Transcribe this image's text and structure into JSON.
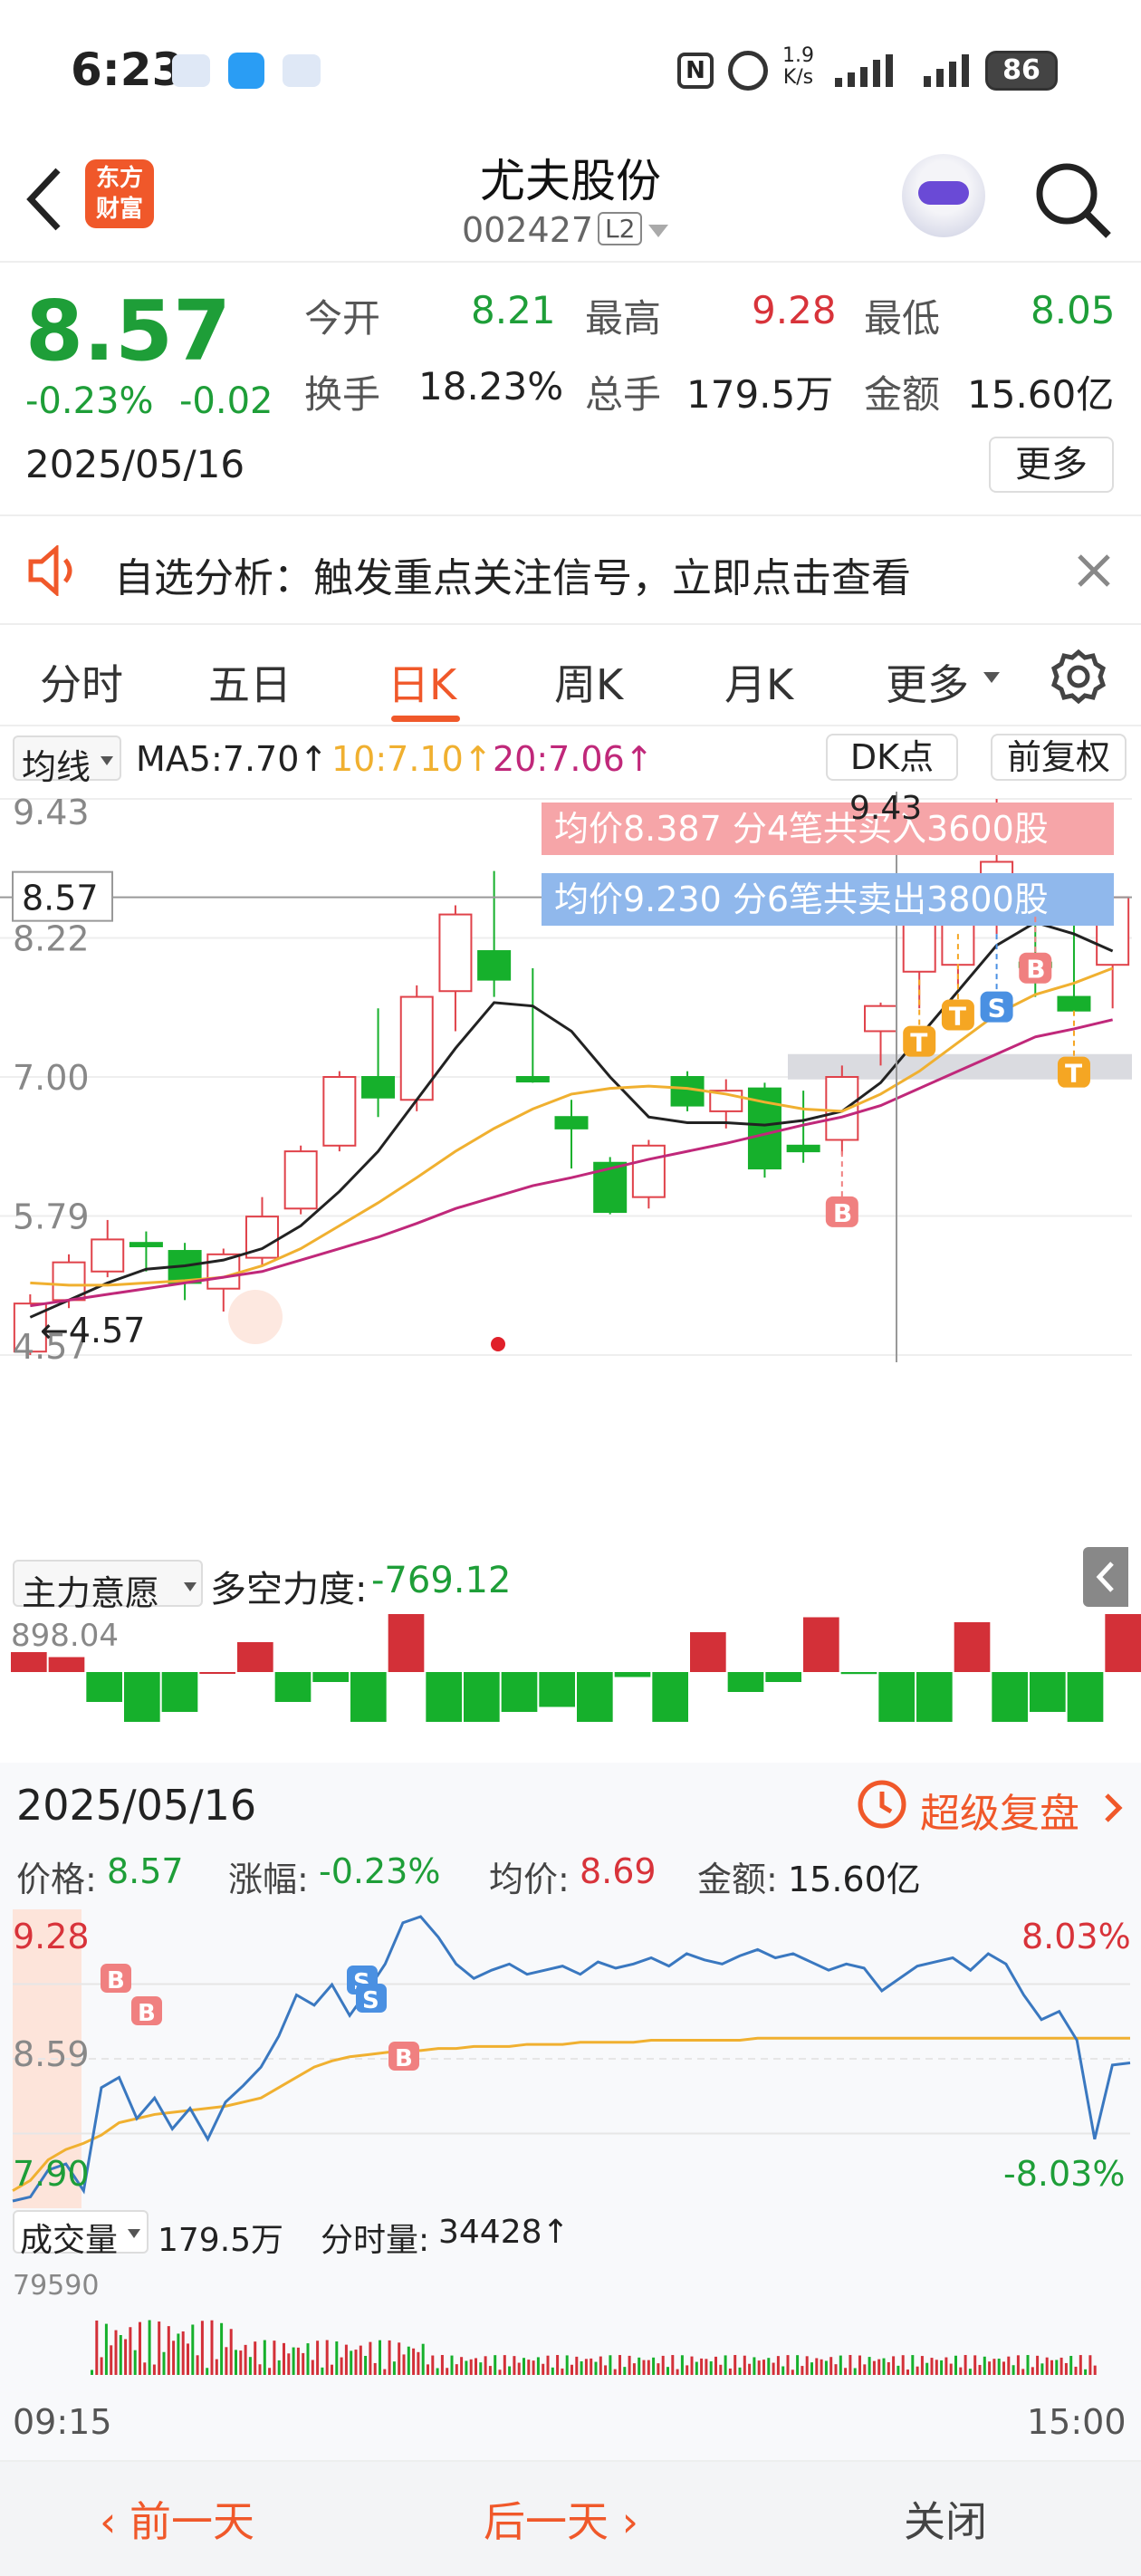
{
  "status_bar": {
    "time": "6:23",
    "net_speed_value": "1.9",
    "net_speed_unit": "K/s",
    "battery": "86"
  },
  "header": {
    "title": "尤夫股份",
    "code": "002427",
    "level_badge": "L2",
    "logo_line1": "东方",
    "logo_line2": "财富"
  },
  "quote": {
    "price": "8.57",
    "change_pct": "-0.23%",
    "change_abs": "-0.02",
    "date": "2025/05/16",
    "open_label": "今开",
    "open_value": "8.21",
    "high_label": "最高",
    "high_value": "9.28",
    "low_label": "最低",
    "low_value": "8.05",
    "turnover_label": "换手",
    "turnover_value": "18.23%",
    "volume_label": "总手",
    "volume_value": "179.5万",
    "amount_label": "金额",
    "amount_value": "15.60亿",
    "more_label": "更多"
  },
  "notice": {
    "text": "自选分析：触发重点关注信号，立即点击查看"
  },
  "tabs": {
    "items": [
      "分时",
      "五日",
      "日K",
      "周K",
      "月K"
    ],
    "more": "更多"
  },
  "kline": {
    "ma_selector": "均线",
    "ma5": "MA5:7.70↑",
    "ma10": "10:7.10↑",
    "ma20": "20:7.06↑",
    "dk_label": "DK点",
    "adjust_label": "前复权",
    "y_labels": [
      "9.43",
      "8.22",
      "7.00",
      "5.79",
      "4.57"
    ],
    "current_price_tag": "8.57",
    "buy_note": "均价8.387  分4笔共买入3600股",
    "sell_note": "均价9.230  分6笔共卖出3800股",
    "peak_label": "9.43",
    "low_label": "←4.57",
    "colors": {
      "up": "#e0424a",
      "down": "#16b02c",
      "ma5": "#222222",
      "ma10": "#f0b030",
      "ma20": "#c0287a",
      "buy": "#f08080",
      "sell": "#4a90e2",
      "t": "#f5a623"
    },
    "chart_data": {
      "type": "candlestick",
      "candles": [
        {
          "o": 4.6,
          "h": 5.1,
          "l": 4.57,
          "c": 5.02
        },
        {
          "o": 5.05,
          "h": 5.45,
          "l": 4.98,
          "c": 5.38
        },
        {
          "o": 5.3,
          "h": 5.75,
          "l": 5.25,
          "c": 5.58
        },
        {
          "o": 5.55,
          "h": 5.65,
          "l": 5.3,
          "c": 5.52
        },
        {
          "o": 5.48,
          "h": 5.55,
          "l": 5.05,
          "c": 5.2
        },
        {
          "o": 5.15,
          "h": 5.5,
          "l": 4.95,
          "c": 5.45
        },
        {
          "o": 5.42,
          "h": 5.95,
          "l": 5.35,
          "c": 5.78
        },
        {
          "o": 5.85,
          "h": 6.4,
          "l": 5.8,
          "c": 6.35
        },
        {
          "o": 6.4,
          "h": 7.05,
          "l": 6.35,
          "c": 7.0
        },
        {
          "o": 7.0,
          "h": 7.6,
          "l": 6.65,
          "c": 6.82
        },
        {
          "o": 6.8,
          "h": 7.8,
          "l": 6.7,
          "c": 7.7
        },
        {
          "o": 7.75,
          "h": 8.5,
          "l": 7.4,
          "c": 8.42
        },
        {
          "o": 8.1,
          "h": 8.8,
          "l": 7.7,
          "c": 7.85
        },
        {
          "o": 7.0,
          "h": 7.95,
          "l": 6.95,
          "c": 6.96
        },
        {
          "o": 6.65,
          "h": 6.8,
          "l": 6.2,
          "c": 6.55
        },
        {
          "o": 6.25,
          "h": 6.3,
          "l": 5.8,
          "c": 5.82
        },
        {
          "o": 5.95,
          "h": 6.45,
          "l": 5.85,
          "c": 6.4
        },
        {
          "o": 7.0,
          "h": 7.05,
          "l": 6.7,
          "c": 6.75
        },
        {
          "o": 6.7,
          "h": 6.98,
          "l": 6.55,
          "c": 6.88
        },
        {
          "o": 6.9,
          "h": 6.95,
          "l": 6.12,
          "c": 6.2
        },
        {
          "o": 6.4,
          "h": 6.88,
          "l": 6.25,
          "c": 6.35
        },
        {
          "o": 6.45,
          "h": 7.1,
          "l": 6.32,
          "c": 7.0
        },
        {
          "o": 7.4,
          "h": 7.65,
          "l": 7.1,
          "c": 7.62
        },
        {
          "o": 7.92,
          "h": 8.5,
          "l": 7.6,
          "c": 8.45
        },
        {
          "o": 7.98,
          "h": 8.6,
          "l": 7.8,
          "c": 8.5
        },
        {
          "o": 8.55,
          "h": 9.43,
          "l": 8.25,
          "c": 8.88
        },
        {
          "o": 8.0,
          "h": 8.6,
          "l": 7.7,
          "c": 7.96
        },
        {
          "o": 7.7,
          "h": 8.4,
          "l": 7.6,
          "c": 7.58
        },
        {
          "o": 7.98,
          "h": 8.25,
          "l": 7.6,
          "c": 8.57
        }
      ],
      "ma5": [
        4.9,
        5.05,
        5.2,
        5.32,
        5.35,
        5.4,
        5.5,
        5.7,
        6.0,
        6.35,
        6.8,
        7.25,
        7.65,
        7.62,
        7.4,
        7.0,
        6.65,
        6.6,
        6.6,
        6.58,
        6.62,
        6.7,
        6.95,
        7.35,
        7.75,
        8.15,
        8.35,
        8.25,
        8.1
      ],
      "ma10": [
        5.2,
        5.18,
        5.18,
        5.2,
        5.22,
        5.25,
        5.35,
        5.5,
        5.7,
        5.9,
        6.12,
        6.35,
        6.55,
        6.72,
        6.85,
        6.9,
        6.92,
        6.9,
        6.85,
        6.78,
        6.72,
        6.7,
        6.85,
        7.05,
        7.3,
        7.55,
        7.72,
        7.82,
        7.95
      ],
      "ma20": [
        5.0,
        5.05,
        5.1,
        5.15,
        5.2,
        5.25,
        5.3,
        5.4,
        5.5,
        5.6,
        5.72,
        5.85,
        5.95,
        6.05,
        6.12,
        6.2,
        6.28,
        6.35,
        6.42,
        6.5,
        6.58,
        6.65,
        6.75,
        6.9,
        7.05,
        7.2,
        7.35,
        7.42,
        7.5
      ],
      "y_range": [
        4.57,
        9.43
      ]
    },
    "indicator_selector": "主力意愿",
    "indicator_name": "多空力度:",
    "indicator_value": "-769.12",
    "indicator_max": "898.04",
    "indicator_bars": [
      0.2,
      0.15,
      -0.3,
      -0.5,
      -0.4,
      0.0,
      0.3,
      -0.3,
      -0.1,
      -0.5,
      0.7,
      -0.5,
      -0.5,
      -0.4,
      -0.35,
      -0.5,
      -0.05,
      -0.5,
      0.4,
      -0.2,
      -0.1,
      0.55,
      -0.02,
      -0.5,
      -0.5,
      0.5,
      -0.5,
      -0.4,
      -0.5,
      0.6
    ]
  },
  "detail": {
    "date": "2025/05/16",
    "replay_label": "超级复盘",
    "price_label": "价格:",
    "price_value": "8.57",
    "change_label": "涨幅:",
    "change_value": "-0.23%",
    "avg_label": "均价:",
    "avg_value": "8.69",
    "amount_label": "金额:",
    "amount_value": "15.60亿",
    "y_top": "9.28",
    "y_mid": "8.59",
    "y_bottom": "7.90",
    "pct_top": "8.03%",
    "pct_bottom": "-8.03%",
    "volume_selector": "成交量",
    "volume_value": "179.5万",
    "tick_label": "分时量:",
    "tick_value": "34428↑",
    "vol_max": "79590",
    "time_start": "09:15",
    "time_end": "15:00",
    "chart_data": {
      "type": "line",
      "y_range": [
        7.9,
        9.28
      ],
      "price": [
        7.9,
        7.92,
        8.05,
        8.08,
        7.95,
        8.45,
        8.5,
        8.3,
        8.4,
        8.25,
        8.35,
        8.2,
        8.38,
        8.46,
        8.55,
        8.7,
        8.9,
        8.85,
        8.95,
        8.8,
        8.92,
        9.05,
        9.25,
        9.28,
        9.18,
        9.05,
        8.98,
        9.02,
        9.05,
        9.0,
        9.02,
        9.04,
        9.0,
        9.06,
        9.03,
        9.05,
        9.08,
        9.04,
        9.1,
        9.07,
        9.05,
        9.09,
        9.12,
        9.08,
        9.1,
        9.06,
        9.02,
        9.05,
        9.03,
        8.92,
        8.98,
        9.04,
        9.06,
        9.08,
        9.02,
        9.1,
        9.05,
        8.9,
        8.78,
        8.82,
        8.68,
        8.2,
        8.56,
        8.57
      ],
      "avg": [
        7.95,
        8.0,
        8.1,
        8.15,
        8.18,
        8.22,
        8.28,
        8.3,
        8.32,
        8.33,
        8.34,
        8.35,
        8.36,
        8.38,
        8.4,
        8.45,
        8.5,
        8.55,
        8.58,
        8.6,
        8.61,
        8.62,
        8.63,
        8.63,
        8.64,
        8.64,
        8.65,
        8.65,
        8.65,
        8.66,
        8.66,
        8.66,
        8.67,
        8.67,
        8.67,
        8.67,
        8.68,
        8.68,
        8.68,
        8.68,
        8.68,
        8.68,
        8.69,
        8.69,
        8.69,
        8.69,
        8.69,
        8.69,
        8.69,
        8.69,
        8.69,
        8.69,
        8.69,
        8.69,
        8.69,
        8.69,
        8.69,
        8.69,
        8.69,
        8.69,
        8.69,
        8.69,
        8.69,
        8.69
      ]
    }
  },
  "footer": {
    "prev": "前一天",
    "next": "后一天",
    "close": "关闭"
  }
}
